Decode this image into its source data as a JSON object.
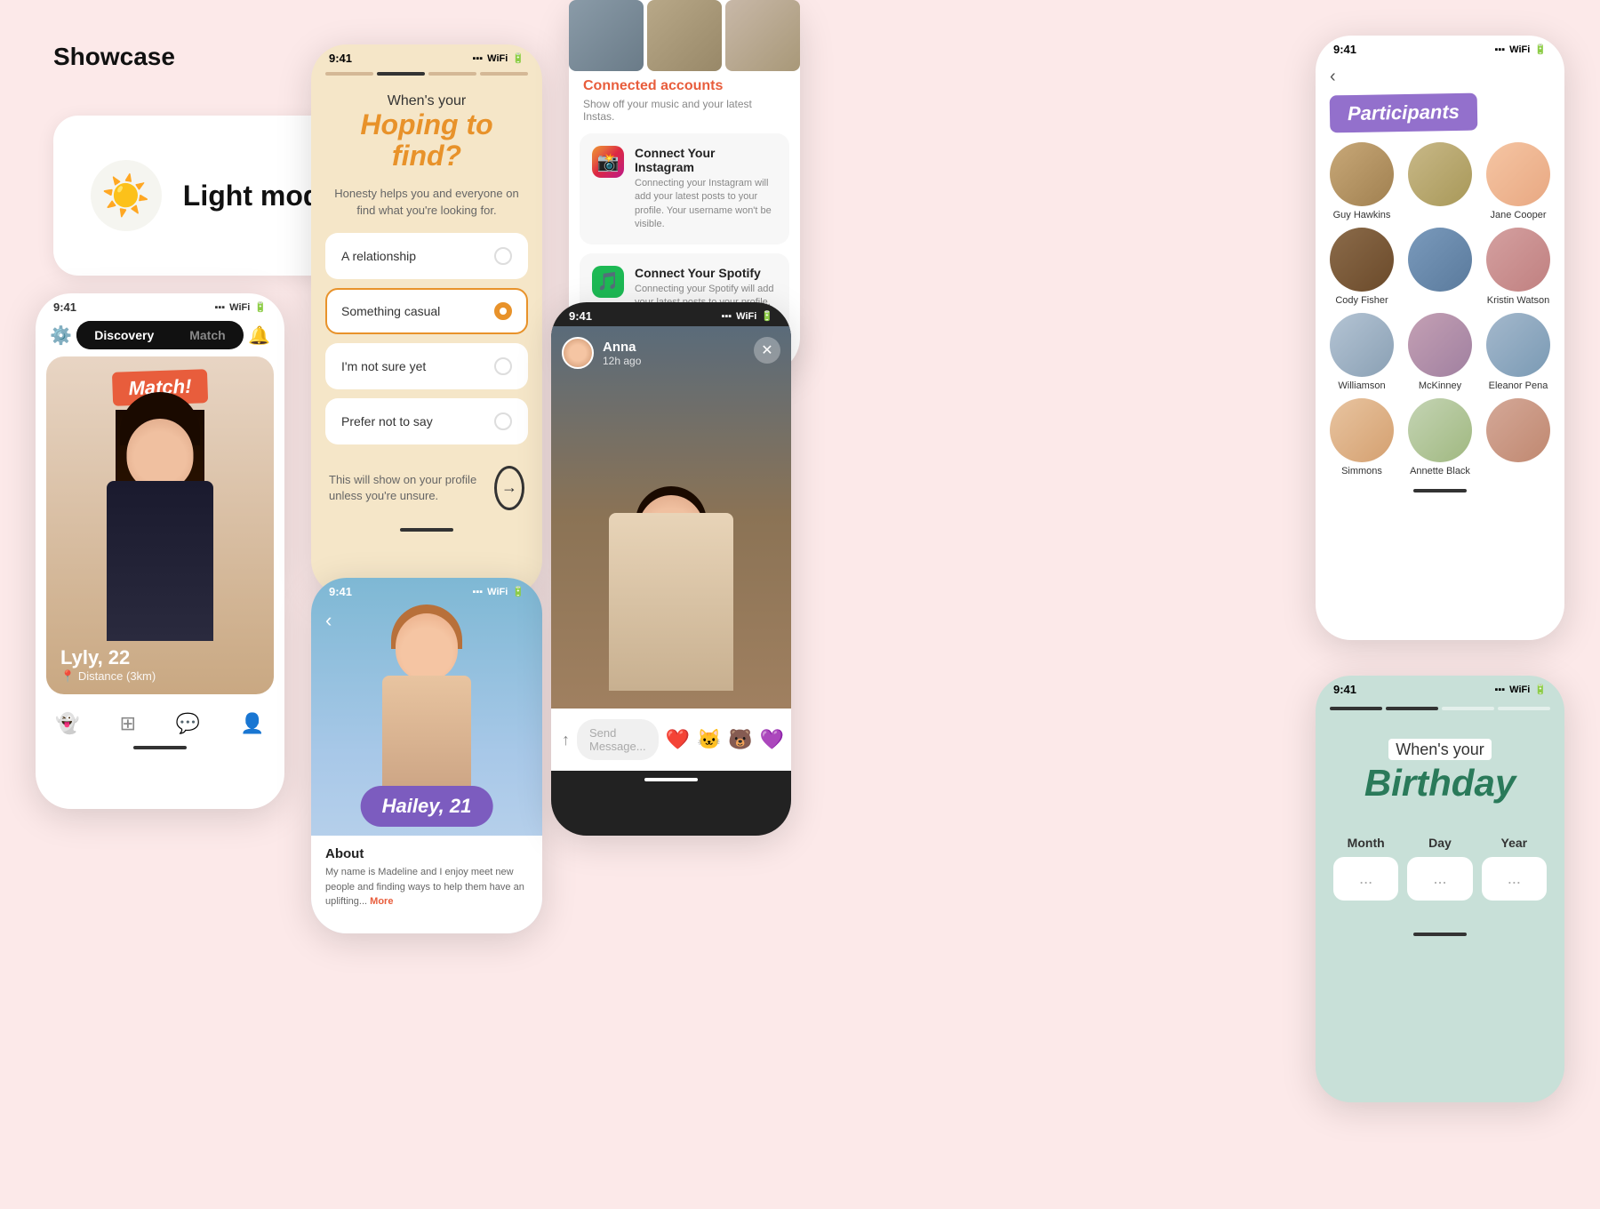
{
  "page": {
    "title": "Showcase"
  },
  "light_mode": {
    "label": "Light mode",
    "icon": "☀️"
  },
  "phone_match": {
    "status_time": "9:41",
    "tabs": [
      "Discovery",
      "Match"
    ],
    "active_tab": "Discovery",
    "match_badge": "Match!",
    "profile_name": "Lyly, 22",
    "profile_distance": "Distance (3km)"
  },
  "phone_hoping": {
    "status_time": "9:41",
    "header_small": "When's your",
    "header_big": "Hoping to find?",
    "subtitle": "Honesty helps you and everyone on find what you're looking for.",
    "options": [
      {
        "label": "A relationship",
        "selected": false
      },
      {
        "label": "Something casual",
        "selected": true
      },
      {
        "label": "I'm not sure yet",
        "selected": false
      },
      {
        "label": "Prefer not to say",
        "selected": false
      }
    ],
    "footer_text": "This will show on your profile unless you're unsure."
  },
  "phone_connected": {
    "status_time": "9:41",
    "section_title": "Connected accounts",
    "section_sub": "Show off your music and your latest Instas.",
    "items": [
      {
        "title": "Connect Your Instagram",
        "desc": "Connecting your Instagram will add your latest posts to your profile. Your username won't be visible.",
        "icon": "ig"
      },
      {
        "title": "Connect Your Spotify",
        "desc": "Connecting your Spotify will add your latest posts to your profile. Your username won't be visible.",
        "icon": "sp"
      }
    ]
  },
  "phone_hailey": {
    "status_time": "9:41",
    "name_badge": "Hailey, 21",
    "about_title": "About",
    "about_text": "My name is Madeline and I enjoy meet new people and finding ways to help them have an uplifting...",
    "more_label": "More"
  },
  "phone_anna": {
    "status_time": "9:41",
    "user_name": "Anna",
    "user_time": "12h ago",
    "message_placeholder": "Send Message...",
    "reactions": [
      "❤️",
      "🐱",
      "🐻",
      "💜"
    ]
  },
  "phone_participants": {
    "status_time": "9:41",
    "title": "Participants",
    "participants": [
      {
        "name": "Guy Hawkins",
        "color": "av2"
      },
      {
        "name": "",
        "color": "av3"
      },
      {
        "name": "Jane Cooper",
        "color": "av1"
      },
      {
        "name": "Cody Fisher",
        "color": "av4"
      },
      {
        "name": "",
        "color": "av6"
      },
      {
        "name": "Kristin Watson",
        "color": "av5"
      },
      {
        "name": "Williamson",
        "color": "av7"
      },
      {
        "name": "McKinney",
        "color": "av8"
      },
      {
        "name": "Eleanor Pena",
        "color": "av9"
      },
      {
        "name": "Simmons",
        "color": "av10"
      },
      {
        "name": "Annette Black",
        "color": "av11"
      },
      {
        "name": "",
        "color": "av3"
      }
    ]
  },
  "phone_birthday": {
    "status_time": "9:41",
    "header_small": "When's your",
    "header_big": "Birthday",
    "labels": [
      "Month",
      "Day",
      "Year"
    ],
    "placeholders": [
      "...",
      "...",
      "..."
    ]
  }
}
